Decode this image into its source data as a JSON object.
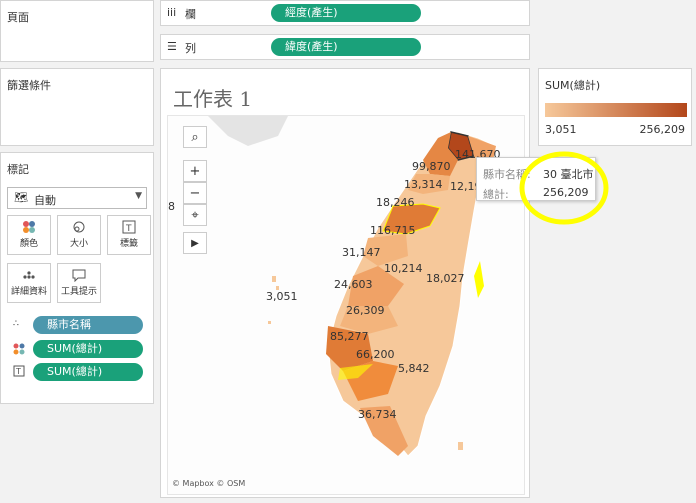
{
  "pages_panel": {
    "title": "頁面"
  },
  "filters_panel": {
    "title": "篩選條件"
  },
  "columns_shelf": {
    "label": "欄",
    "pill": "經度(產生)"
  },
  "rows_shelf": {
    "label": "列",
    "pill": "緯度(產生)"
  },
  "marks_panel": {
    "title": "標記",
    "mark_type": "自動",
    "buttons": [
      {
        "label": "顏色",
        "icon": "color-dots-icon"
      },
      {
        "label": "大小",
        "icon": "size-icon"
      },
      {
        "label": "標籤",
        "icon": "label-icon"
      },
      {
        "label": "詳細資料",
        "icon": "detail-icon"
      },
      {
        "label": "工具提示",
        "icon": "tooltip-icon"
      }
    ],
    "fields": [
      {
        "role": "detail",
        "name": "縣市名稱"
      },
      {
        "role": "color",
        "name": "SUM(總計)"
      },
      {
        "role": "label",
        "name": "SUM(總計)"
      }
    ]
  },
  "worksheet": {
    "title": "工作表 1",
    "map_credit": "© Mapbox © OSM",
    "labels": [
      "99,870",
      "13,314",
      "18,246",
      "116,715",
      "31,147",
      "10,214",
      "18,027",
      "24,603",
      "3,051",
      "26,309",
      "85,277",
      "66,200",
      "5,842",
      "36,734",
      "12,19",
      "141,670",
      "8"
    ]
  },
  "legend": {
    "title": "SUM(總計)",
    "min": "3,051",
    "max": "256,209",
    "color_low": "#f6c89a",
    "color_high": "#b3471b"
  },
  "tooltip": {
    "key1": "縣市名稱:",
    "val1": "30 臺北市",
    "key2": "總計:",
    "val2": "256,209"
  },
  "colors": {
    "pill_green": "#1aa17a",
    "pill_blue": "#4c97ad",
    "highlight": "#ffff00"
  }
}
